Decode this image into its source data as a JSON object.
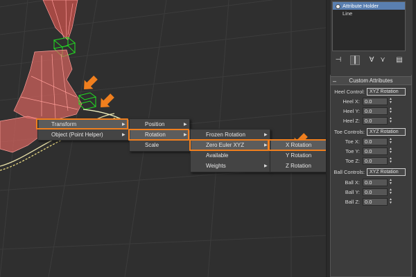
{
  "panel": {
    "stack": {
      "items": [
        {
          "label": "Attribute Holder",
          "selected": true
        },
        {
          "label": "Line",
          "selected": false
        }
      ]
    },
    "tools": [
      "pin-stack-icon",
      "show-end-result-icon",
      "make-unique-icon",
      "remove-modifier-icon",
      "configure-modifier-sets-icon"
    ],
    "rollout": {
      "title": "Custom Attributes",
      "heel_control": {
        "label": "Heel Control:",
        "value": "XYZ Rotation"
      },
      "heel_x": {
        "label": "Heel X:",
        "value": "0.0"
      },
      "heel_y": {
        "label": "Heel Y:",
        "value": "0.0"
      },
      "heel_z": {
        "label": "Heel Z:",
        "value": "0.0"
      },
      "toe_controls": {
        "label": "Toe Controls:",
        "value": "XYZ Rotation"
      },
      "toe_x": {
        "label": "Toe X:",
        "value": "0.0"
      },
      "toe_y": {
        "label": "Toe Y:",
        "value": "0.0"
      },
      "toe_z": {
        "label": "Toe Z:",
        "value": "0.0"
      },
      "ball_controls": {
        "label": "Ball Controls:",
        "value": "XYZ Rotation"
      },
      "ball_x": {
        "label": "Ball X:",
        "value": "0.0"
      },
      "ball_y": {
        "label": "Ball Y:",
        "value": "0.0"
      },
      "ball_z": {
        "label": "Ball Z:",
        "value": "0.0"
      }
    }
  },
  "menus": {
    "level1": {
      "transform": "Transform",
      "object": "Object (Point Helper)"
    },
    "level2": {
      "position": "Position",
      "rotation": "Rotation",
      "scale": "Scale"
    },
    "level3": {
      "frozen": "Frozen Rotation",
      "zero_euler": "Zero Euler XYZ",
      "available": "Available",
      "weights": "Weights"
    },
    "level4": {
      "x": "X Rotation",
      "y": "Y Rotation",
      "z": "Z Rotation"
    }
  },
  "colors": {
    "highlight": "#f07f1e",
    "selection": "#5a7fb0",
    "mesh": "#e0605a",
    "helper": "#22e022"
  }
}
